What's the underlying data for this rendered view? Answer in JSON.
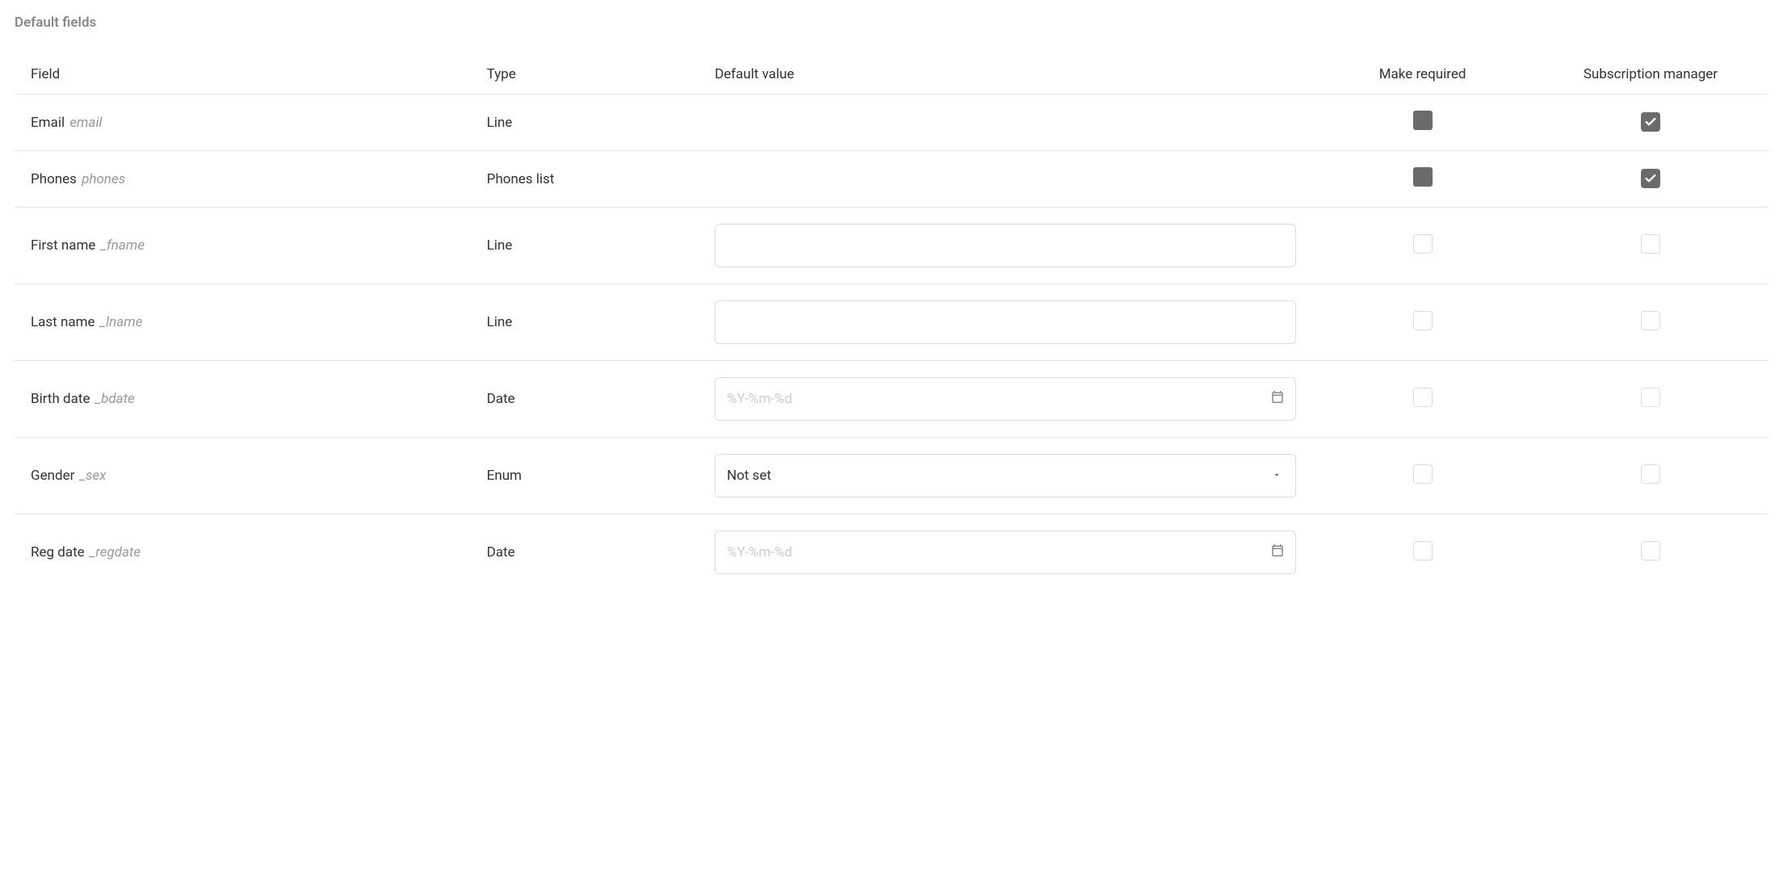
{
  "section_title": "Default fields",
  "headers": {
    "field": "Field",
    "type": "Type",
    "default_value": "Default value",
    "make_required": "Make required",
    "subscription_manager": "Subscription manager"
  },
  "rows": [
    {
      "label": "Email",
      "id": "email",
      "type": "Line",
      "default_kind": "none",
      "default_value": "",
      "placeholder": "",
      "required_state": "filled",
      "subscription_state": "checked"
    },
    {
      "label": "Phones",
      "id": "phones",
      "type": "Phones list",
      "default_kind": "none",
      "default_value": "",
      "placeholder": "",
      "required_state": "filled",
      "subscription_state": "checked"
    },
    {
      "label": "First name",
      "id": "_fname",
      "type": "Line",
      "default_kind": "text",
      "default_value": "",
      "placeholder": "",
      "required_state": "unchecked",
      "subscription_state": "unchecked"
    },
    {
      "label": "Last name",
      "id": "_lname",
      "type": "Line",
      "default_kind": "text",
      "default_value": "",
      "placeholder": "",
      "required_state": "unchecked",
      "subscription_state": "unchecked"
    },
    {
      "label": "Birth date",
      "id": "_bdate",
      "type": "Date",
      "default_kind": "date",
      "default_value": "",
      "placeholder": "%Y-%m-%d",
      "required_state": "unchecked",
      "subscription_state": "unchecked"
    },
    {
      "label": "Gender",
      "id": "_sex",
      "type": "Enum",
      "default_kind": "select",
      "default_value": "Not set",
      "placeholder": "",
      "required_state": "unchecked",
      "subscription_state": "unchecked"
    },
    {
      "label": "Reg date",
      "id": "_regdate",
      "type": "Date",
      "default_kind": "date",
      "default_value": "",
      "placeholder": "%Y-%m-%d",
      "required_state": "unchecked",
      "subscription_state": "unchecked"
    }
  ]
}
